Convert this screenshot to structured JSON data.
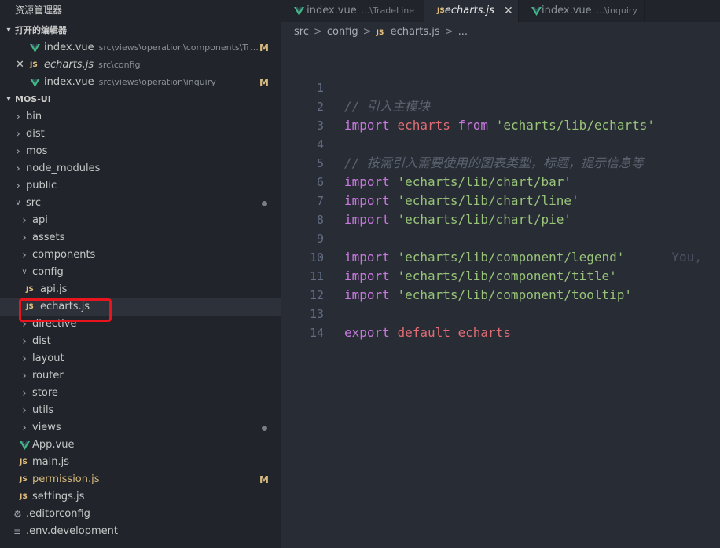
{
  "sidebar": {
    "title": "资源管理器",
    "open_editors_label": "打开的编辑器",
    "open_editors": [
      {
        "name": "index.vue",
        "path": "src\\views\\operation\\components\\Trad...",
        "badge": "M",
        "icon": "vue-icon"
      },
      {
        "name": "echarts.js",
        "path": "src\\config",
        "badge": "",
        "icon": "js-icon"
      },
      {
        "name": "index.vue",
        "path": "src\\views\\operation\\inquiry",
        "badge": "M",
        "icon": "vue-icon"
      }
    ],
    "project_label": "MOS-UI",
    "tree": {
      "bin": "bin",
      "dist": "dist",
      "mos": "mos",
      "node_modules": "node_modules",
      "public": "public",
      "src": "src",
      "api": "api",
      "assets": "assets",
      "components": "components",
      "config": "config",
      "api_js": "api.js",
      "echarts_js": "echarts.js",
      "directive": "directive",
      "dist2": "dist",
      "layout": "layout",
      "router": "router",
      "store": "store",
      "utils": "utils",
      "views": "views",
      "app_vue": "App.vue",
      "main_js": "main.js",
      "permission_js": "permission.js",
      "permission_badge": "M",
      "settings_js": "settings.js",
      "editorconfig": ".editorconfig",
      "env_development": ".env.development"
    },
    "js_label": "JS"
  },
  "tabs": [
    {
      "name": "index.vue",
      "sub": "...\\TradeLine"
    },
    {
      "name": "echarts.js",
      "sub": ""
    },
    {
      "name": "index.vue",
      "sub": "...\\inquiry"
    }
  ],
  "breadcrumb": {
    "a": "src",
    "b": "config",
    "c": "echarts.js",
    "d": "...",
    "sep": ">"
  },
  "editor": {
    "lines": {
      "n1": "1",
      "n2": "2",
      "n3": "3",
      "n4": "4",
      "n5": "5",
      "n6": "6",
      "n7": "7",
      "n8": "8",
      "n9": "9",
      "n10": "10",
      "n11": "11",
      "n12": "12",
      "n13": "13",
      "n14": "14"
    },
    "l1_comment": "// 引入主模块",
    "kw_import": "import",
    "kw_from": "from",
    "kw_export": "export",
    "kw_default": "default",
    "var_echarts": "echarts",
    "l2_str": "'echarts/lib/echarts'",
    "l4_comment": "// 按需引入需要使用的图表类型，标题，提示信息等",
    "l5_str": "'echarts/lib/chart/bar'",
    "l6_str": "'echarts/lib/chart/line'",
    "l7_str": "'echarts/lib/chart/pie'",
    "l9_str": "'echarts/lib/component/legend'",
    "l9_blame": "You,",
    "l10_str": "'echarts/lib/component/title'",
    "l11_str": "'echarts/lib/component/tooltip'"
  },
  "colors": {
    "highlight": "#e8151e",
    "vue_green": "#41b883",
    "js_yellow": "#e5c07b"
  }
}
